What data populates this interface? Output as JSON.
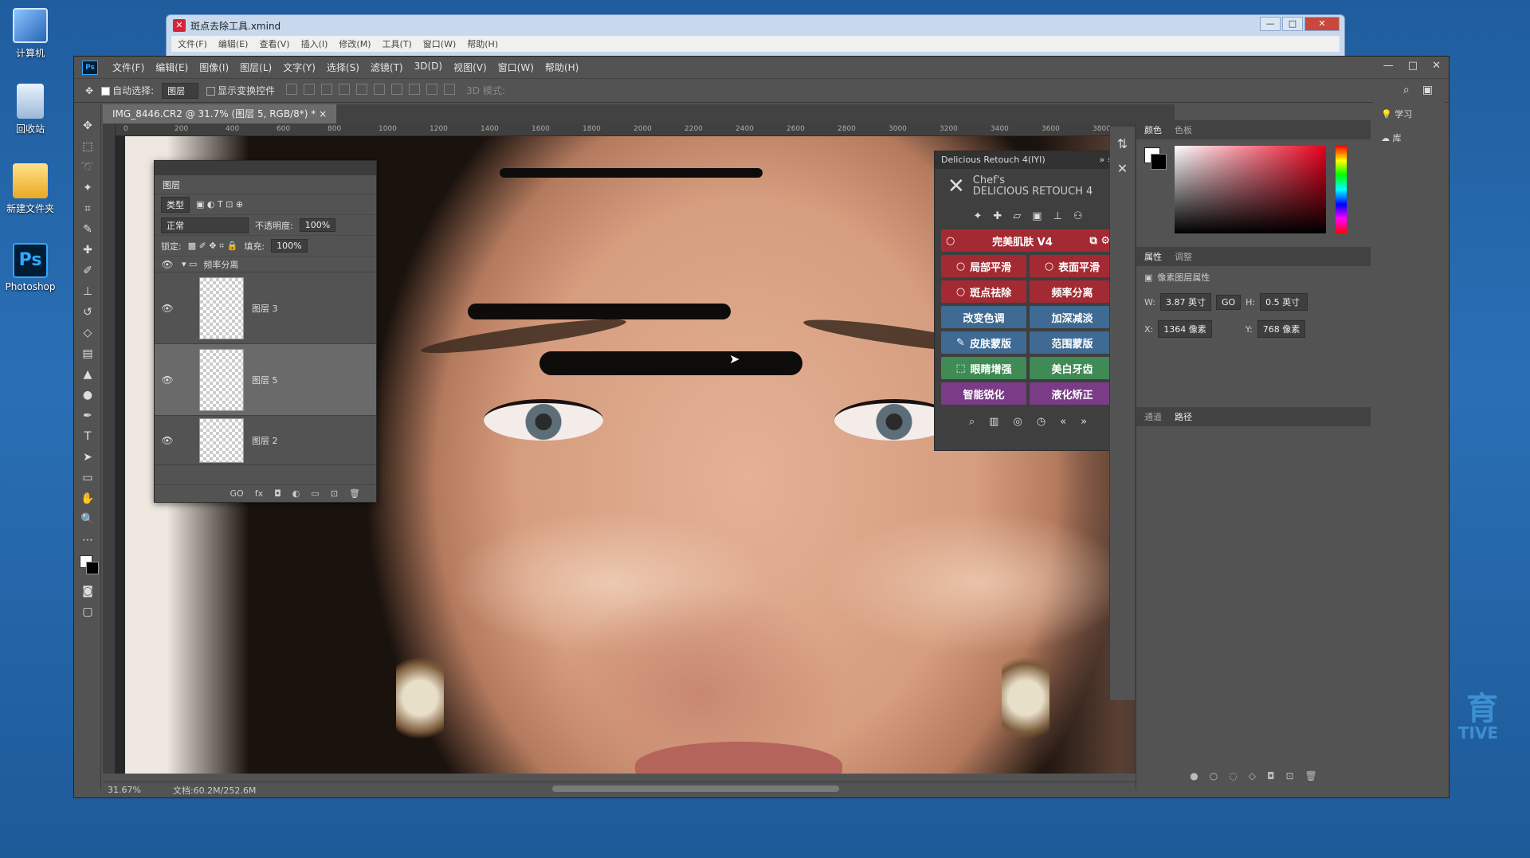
{
  "desktop": {
    "icons": [
      {
        "label": "计算机"
      },
      {
        "label": "回收站"
      },
      {
        "label": "新建文件夹"
      },
      {
        "label": "Photoshop"
      }
    ],
    "watermark": {
      "line1": "育",
      "line2": "TIVE"
    }
  },
  "xmind": {
    "title": "斑点去除工具.xmind",
    "menu": [
      "文件(F)",
      "编辑(E)",
      "查看(V)",
      "插入(I)",
      "修改(M)",
      "工具(T)",
      "窗口(W)",
      "帮助(H)"
    ],
    "controls": [
      "—",
      "□",
      "✕"
    ]
  },
  "ps": {
    "logo": "Ps",
    "menu": [
      "文件(F)",
      "编辑(E)",
      "图像(I)",
      "图层(L)",
      "文字(Y)",
      "选择(S)",
      "滤镜(T)",
      "3D(D)",
      "视图(V)",
      "窗口(W)",
      "帮助(H)"
    ],
    "controls": [
      "—",
      "□",
      "✕"
    ],
    "options": {
      "auto_select_label": "自动选择:",
      "auto_select_value": "图层",
      "show_transform": "显示变换控件",
      "mode_3d": "3D 模式:"
    },
    "doc_tab": "IMG_8446.CR2 @ 31.7% (图层 5, RGB/8*) *",
    "ruler_ticks": [
      "0",
      "200",
      "400",
      "600",
      "800",
      "1000",
      "1200",
      "1400",
      "1600",
      "1800",
      "2000",
      "2200",
      "2400",
      "2600",
      "2800",
      "3000",
      "3200",
      "3400",
      "3600",
      "3800"
    ],
    "status": {
      "zoom": "31.67%",
      "doc": "文档:60.2M/252.6M"
    }
  },
  "layers_panel": {
    "tab": "图层",
    "kind_filter": "类型",
    "blend_mode": "正常",
    "opacity_label": "不透明度:",
    "opacity_value": "100%",
    "lock_label": "锁定:",
    "fill_label": "填充:",
    "fill_value": "100%",
    "group_name": "频率分离",
    "layers": [
      {
        "name": "图层 3",
        "selected": false
      },
      {
        "name": "图层 5",
        "selected": true
      },
      {
        "name": "图层 2",
        "selected": false
      }
    ],
    "footer": [
      "GO",
      "fx",
      "◘",
      "◐",
      "▭",
      "⊡",
      "🗑"
    ]
  },
  "retouch_panel": {
    "title": "Delicious Retouch 4(IYI)",
    "brand_line1": "Chef's",
    "brand_line2": "DELICIOUS RETOUCH 4",
    "buttons": [
      {
        "label": "完美肌肤 V4",
        "color": "red",
        "wide": true
      },
      {
        "label": "局部平滑",
        "color": "red"
      },
      {
        "label": "表面平滑",
        "color": "red"
      },
      {
        "label": "斑点祛除",
        "color": "red"
      },
      {
        "label": "频率分离",
        "color": "red"
      },
      {
        "label": "改变色调",
        "color": "blue"
      },
      {
        "label": "加深减淡",
        "color": "blue"
      },
      {
        "label": "皮肤蒙版",
        "color": "blue"
      },
      {
        "label": "范围蒙版",
        "color": "blue"
      },
      {
        "label": "眼睛增强",
        "color": "green"
      },
      {
        "label": "美白牙齿",
        "color": "green"
      },
      {
        "label": "智能锐化",
        "color": "purple"
      },
      {
        "label": "液化矫正",
        "color": "purple"
      }
    ]
  },
  "right_panel": {
    "color_tabs": [
      "颜色",
      "色板"
    ],
    "prop_tabs": [
      "属性",
      "调整"
    ],
    "prop_title": "像素图层属性",
    "w_label": "W:",
    "w_value": "3.87 英寸",
    "h_label": "H:",
    "h_value": "0.5 英寸",
    "go": "GO",
    "x_label": "X:",
    "x_value": "1364 像素",
    "y_label": "Y:",
    "y_value": "768 像素",
    "bottom_tabs": [
      "通道",
      "路径"
    ],
    "learn": "学习",
    "library": "库"
  }
}
